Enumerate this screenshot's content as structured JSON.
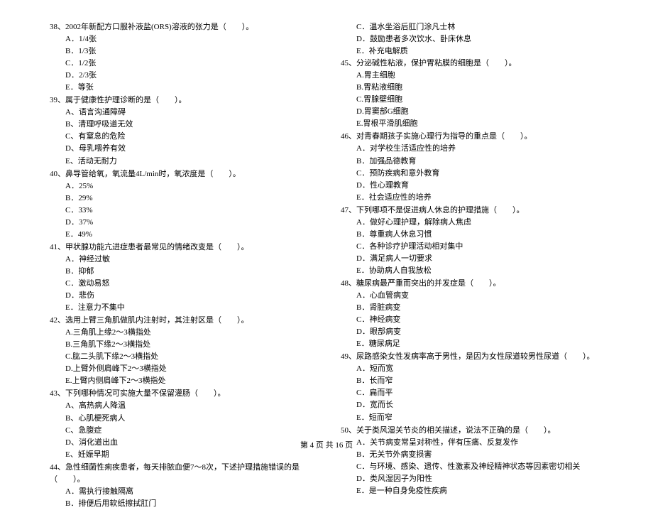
{
  "left": [
    {
      "num": "38、",
      "text": "2002年新配方口服补液盐(ORS)溶液的张力是（　　）。",
      "options": [
        "A．1/4张",
        "B．1/3张",
        "C．1/2张",
        "D．2/3张",
        "E．等张"
      ]
    },
    {
      "num": "39、",
      "text": "属于健康性护理诊断的是（　　）。",
      "options": [
        "A、语言沟通障碍",
        "B、清理呼吸道无效",
        "C、有窒息的危险",
        "D、母乳喂养有效",
        "E、活动无耐力"
      ]
    },
    {
      "num": "40、",
      "text": "鼻导管给氧，氧流量4L/min时，氧浓度是（　　）。",
      "options": [
        "A．25%",
        "B．29%",
        "C．33%",
        "D．37%",
        "E．49%"
      ]
    },
    {
      "num": "41、",
      "text": "甲状腺功能亢进症患者最常见的情绪改变是（　　）。",
      "options": [
        "A．神经过敏",
        "B．抑郁",
        "C．激动易怒",
        "D．悲伤",
        "E．注意力不集中"
      ]
    },
    {
      "num": "42、",
      "text": "选用上臂三角肌做肌内注射时，其注射区是（　　）。",
      "options": [
        "A.三角肌上缘2～3横指处",
        "B.三角肌下缘2～3横指处",
        "C.肱二头肌下缘2～3横指处",
        "D.上臂外侧肩峰下2～3横指处",
        "E.上臂内侧肩峰下2～3横指处"
      ]
    },
    {
      "num": "43、",
      "text": "下列哪种情况可实施大量不保留灌肠（　　）。",
      "options": [
        "A、高热病人降温",
        "B、心肌梗死病人",
        "C、急腹症",
        "D、消化道出血",
        "E、妊娠早期"
      ]
    },
    {
      "num": "44、",
      "text": "急性细菌性痢疾患者，每天排脓血便7～8次，下述护理措施错误的是（　　）。",
      "options": [
        "A．需执行接触隔离",
        "B．排便后用软纸擦拭肛门"
      ]
    }
  ],
  "right_continue": [
    "C．温水坐浴后肛门涂凡士林",
    "D．鼓励患者多次饮水、卧床休息",
    "E．补充电解质"
  ],
  "right": [
    {
      "num": "45、",
      "text": "分泌碱性粘液，保护胃粘膜的细胞是（　　）。",
      "options": [
        "A.胃主细胞",
        "B.胃粘液细胞",
        "C.胃腺壁细胞",
        "D.胃窦部G细胞",
        "E.胃根平滑肌细胞"
      ]
    },
    {
      "num": "46、",
      "text": "对青春期孩子实施心理行为指导的重点是（　　）。",
      "options": [
        "A．对学校生活适应性的培养",
        "B．加强品德教育",
        "C．预防疾病和意外教育",
        "D．性心理教育",
        "E．社会适应性的培养"
      ]
    },
    {
      "num": "47、",
      "text": "下列哪项不是促进病人休息的护理措施（　　）。",
      "options": [
        "A．做好心理护理，解除病人焦虑",
        "B．尊重病人休息习惯",
        "C．各种诊疗护理活动相对集中",
        "D．满足病人一切要求",
        "E．协助病人自我放松"
      ]
    },
    {
      "num": "48、",
      "text": "糖尿病最严重而突出的并发症是（　　）。",
      "options": [
        "A．心血管病变",
        "B．肾脏病变",
        "C．神经病变",
        "D．眼部病变",
        "E．糖尿病足"
      ]
    },
    {
      "num": "49、",
      "text": "尿路感染女性发病率高于男性，是因为女性尿道较男性尿道（　　）。",
      "options": [
        "A．短而宽",
        "B．长而窄",
        "C．扁而平",
        "D．宽而长",
        "E．短而窄"
      ]
    },
    {
      "num": "50、",
      "text": "关于类风湿关节炎的相关描述，说法不正确的是（　　）。",
      "options": [
        "A．关节病变常呈对称性，伴有压痛、反复发作",
        "B．无关节外病变损害",
        "C．与环境、感染、遗传、性激素及神经精神状态等因素密切相关",
        "D．类风湿因子为阳性",
        "E．是一种自身免疫性疾病"
      ]
    }
  ],
  "footer": "第 4 页 共 16 页"
}
